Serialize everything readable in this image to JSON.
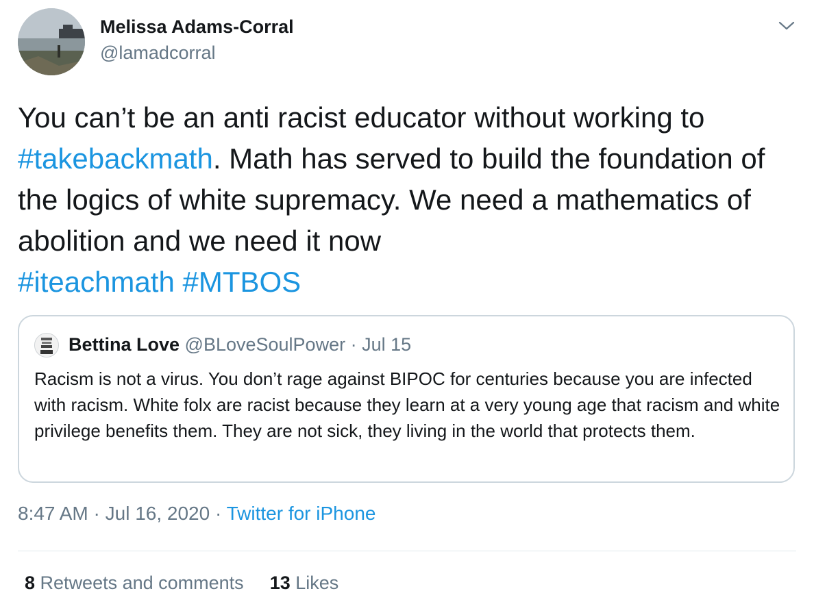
{
  "author": {
    "name": "Melissa Adams-Corral",
    "handle": "@lamadcorral"
  },
  "tweet": {
    "text_1": "You can’t be an anti racist educator without working to ",
    "hashtag_1": "#takebackmath",
    "text_2": ". Math has served to build the foundation of the logics of white supremacy. We need a mathematics of abolition and we need it now ",
    "hashtag_2": "#iteachmath",
    "hashtag_3": "#MTBOS"
  },
  "quote": {
    "name": "Bettina Love",
    "handle": "@BLoveSoulPower",
    "separator": "·",
    "date": "Jul 15",
    "text": "Racism is not a virus. You don’t rage against BIPOC for centuries because you are infected with racism. White folx are racist because they learn at a very young age that racism and white privilege benefits them. They are not sick, they living in the world that protects them."
  },
  "meta": {
    "time": "8:47 AM",
    "separator": "·",
    "date": "Jul 16, 2020",
    "source": "Twitter for iPhone"
  },
  "stats": {
    "retweets_count": "8",
    "retweets_label": "Retweets and comments",
    "likes_count": "13",
    "likes_label": "Likes"
  },
  "icons": {
    "caret": "chevron-down-icon",
    "avatar": "profile-photo",
    "quote_avatar": "profile-photo"
  },
  "colors": {
    "link": "#1b95e0",
    "secondary_text": "#657786",
    "primary_text": "#14171a",
    "border": "#ccd6dd"
  }
}
